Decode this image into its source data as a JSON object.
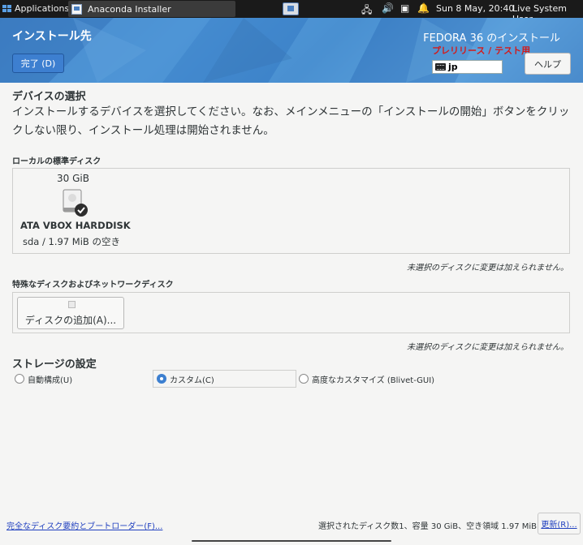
{
  "top_panel": {
    "applications": "Applications",
    "task_title": "Anaconda Installer",
    "clock": "Sun  8 May, 20:40",
    "user": "Live System User"
  },
  "header": {
    "title": "インストール先",
    "done_button": "完了 (D)",
    "product": "FEDORA 36 のインストール",
    "prerelease": "プレリリース / テスト用",
    "keyboard_layout": "jp",
    "help_button": "ヘルプ"
  },
  "device_selection": {
    "heading": "デバイスの選択",
    "description": "インストールするデバイスを選択してください。なお、メインメニューの「インストールの開始」ボタンをクリックしない限り、インストール処理は開始されません。"
  },
  "local_disks": {
    "heading": "ローカルの標準ディスク",
    "disks": [
      {
        "size": "30 GiB",
        "name": "ATA VBOX HARDDISK",
        "info": "sda  /  1.97 MiB の空き",
        "selected": true
      }
    ],
    "note": "未選択のディスクに変更は加えられません。"
  },
  "special_disks": {
    "heading": "特殊なディスクおよびネットワークディスク",
    "add_button": "ディスクの追加(A)...",
    "note": "未選択のディスクに変更は加えられません。"
  },
  "storage_config": {
    "heading": "ストレージの設定",
    "options": [
      {
        "label": "自動構成(U)",
        "selected": false
      },
      {
        "label": "カスタム(C)",
        "selected": true
      },
      {
        "label": "高度なカスタマイズ (Blivet-GUI)",
        "selected": false
      }
    ]
  },
  "footer": {
    "summary_link": "完全なディスク要約とブートローダー(F)...",
    "summary_text": "選択されたディスク数1、容量 30 GiB、空き領域 1.97 MiB",
    "refresh_button": "更新(R)..."
  },
  "colors": {
    "header_blue": "#3d7fc4",
    "accent": "#3c7fd0",
    "prerelease_red": "#d31b1b",
    "link_blue": "#1f3fbf"
  }
}
